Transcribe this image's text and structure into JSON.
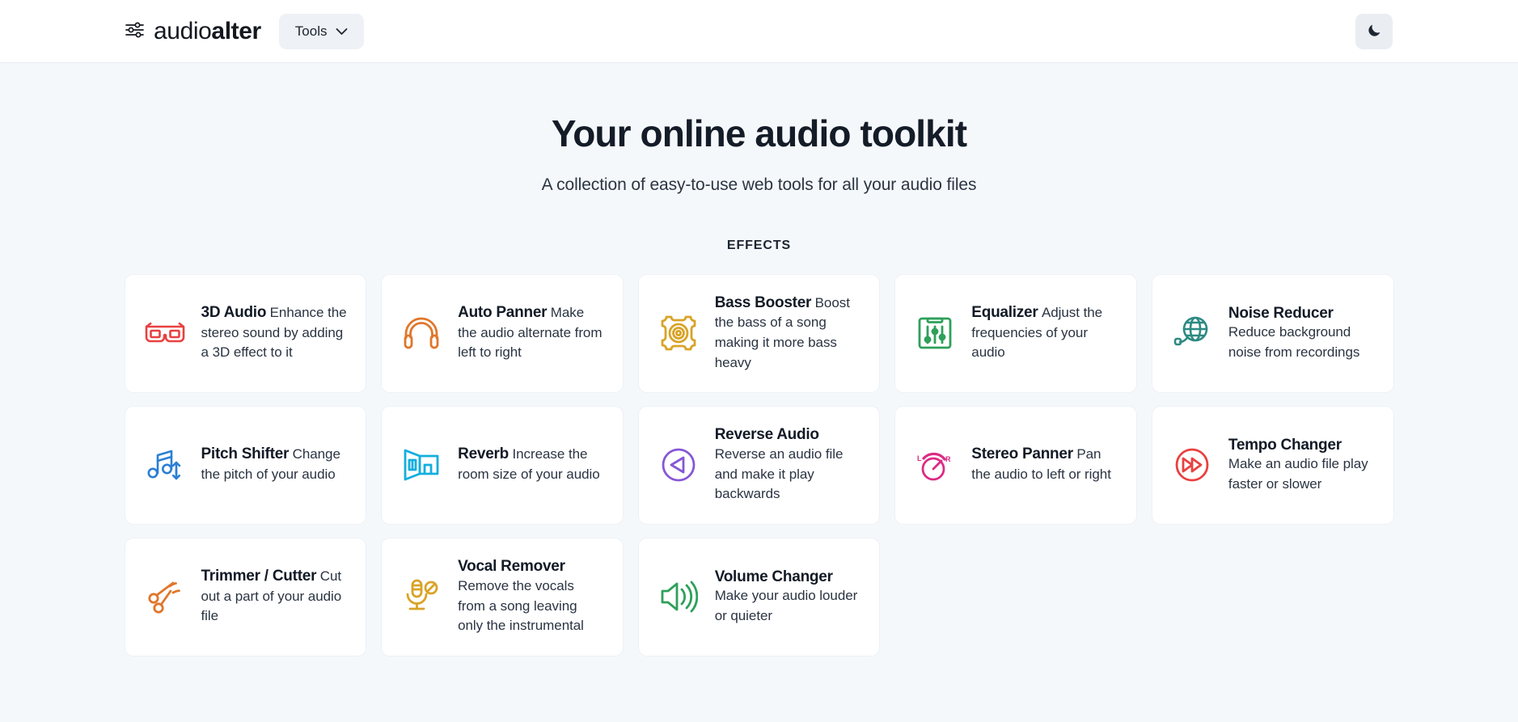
{
  "header": {
    "brand": {
      "icon": "sliders-icon",
      "text_light": "audio",
      "text_bold": "alter"
    },
    "tools_button": {
      "label": "Tools",
      "chevron": "chevron-down-icon"
    },
    "theme_toggle": {
      "icon": "moon-icon",
      "label": "Dark mode"
    }
  },
  "hero": {
    "title": "Your online audio toolkit",
    "subtitle": "A collection of easy-to-use web tools for all your audio files"
  },
  "section": {
    "label": "EFFECTS"
  },
  "colors": {
    "page_background": "#f5f8fb",
    "card_background": "#ffffff",
    "text": "#1c2430",
    "tools_button_background": "#eef1f5"
  },
  "tools": [
    {
      "title": "3D Audio",
      "description": "Enhance the stereo sound by adding a 3D effect to it",
      "icon": "glasses-3d-icon",
      "color": "#e8413f"
    },
    {
      "title": "Auto Panner",
      "description": "Make the audio alternate from left to right",
      "icon": "headphones-icon",
      "color": "#e0762b"
    },
    {
      "title": "Bass Booster",
      "description": "Boost the bass of a song making it more bass heavy",
      "icon": "speaker-woofer-icon",
      "color": "#d9a327"
    },
    {
      "title": "Equalizer",
      "description": "Adjust the frequencies of your audio",
      "icon": "equalizer-sliders-icon",
      "color": "#2ea05a"
    },
    {
      "title": "Noise Reducer",
      "description": "Reduce background noise from recordings",
      "icon": "noise-globe-icon",
      "color": "#2d8a83"
    },
    {
      "title": "Pitch Shifter",
      "description": "Change the pitch of your audio",
      "icon": "music-note-arrows-icon",
      "color": "#2a7fd4"
    },
    {
      "title": "Reverb",
      "description": "Increase the room size of your audio",
      "icon": "room-perspective-icon",
      "color": "#13aede"
    },
    {
      "title": "Reverse Audio",
      "description": "Reverse an audio file and make it play backwards",
      "icon": "reverse-play-icon",
      "color": "#8657d6"
    },
    {
      "title": "Stereo Panner",
      "description": "Pan the audio to left or right",
      "icon": "pan-knob-icon",
      "color": "#dc2a84"
    },
    {
      "title": "Tempo Changer",
      "description": "Make an audio file play faster or slower",
      "icon": "fast-forward-icon",
      "color": "#e8413f"
    },
    {
      "title": "Trimmer / Cutter",
      "description": "Cut out a part of your audio file",
      "icon": "scissors-icon",
      "color": "#e0762b"
    },
    {
      "title": "Vocal Remover",
      "description": "Remove the vocals from a song leaving only the instrumental",
      "icon": "microphone-off-icon",
      "color": "#d9a327"
    },
    {
      "title": "Volume Changer",
      "description": "Make your audio louder or quieter",
      "icon": "speaker-waves-icon",
      "color": "#2ea05a"
    }
  ]
}
